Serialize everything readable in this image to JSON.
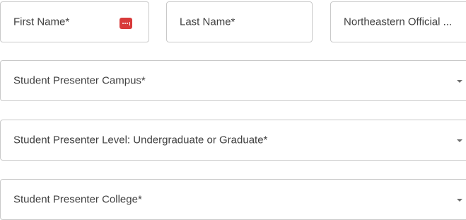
{
  "form": {
    "first_name": {
      "placeholder": "First Name*"
    },
    "last_name": {
      "placeholder": "Last Name*"
    },
    "official_email": {
      "placeholder": "Northeastern Official ..."
    },
    "campus_select": {
      "placeholder": "Student Presenter Campus*"
    },
    "level_select": {
      "placeholder": "Student Presenter Level: Undergraduate or Graduate*"
    },
    "college_select": {
      "placeholder": "Student Presenter College*"
    }
  },
  "icons": {
    "password_manager": "password-manager-icon",
    "dropdown": "chevron-down-icon"
  },
  "colors": {
    "border": "#c9c9c9",
    "text": "#3f3f3f",
    "badge": "#d83a3a",
    "caret": "#707070"
  }
}
